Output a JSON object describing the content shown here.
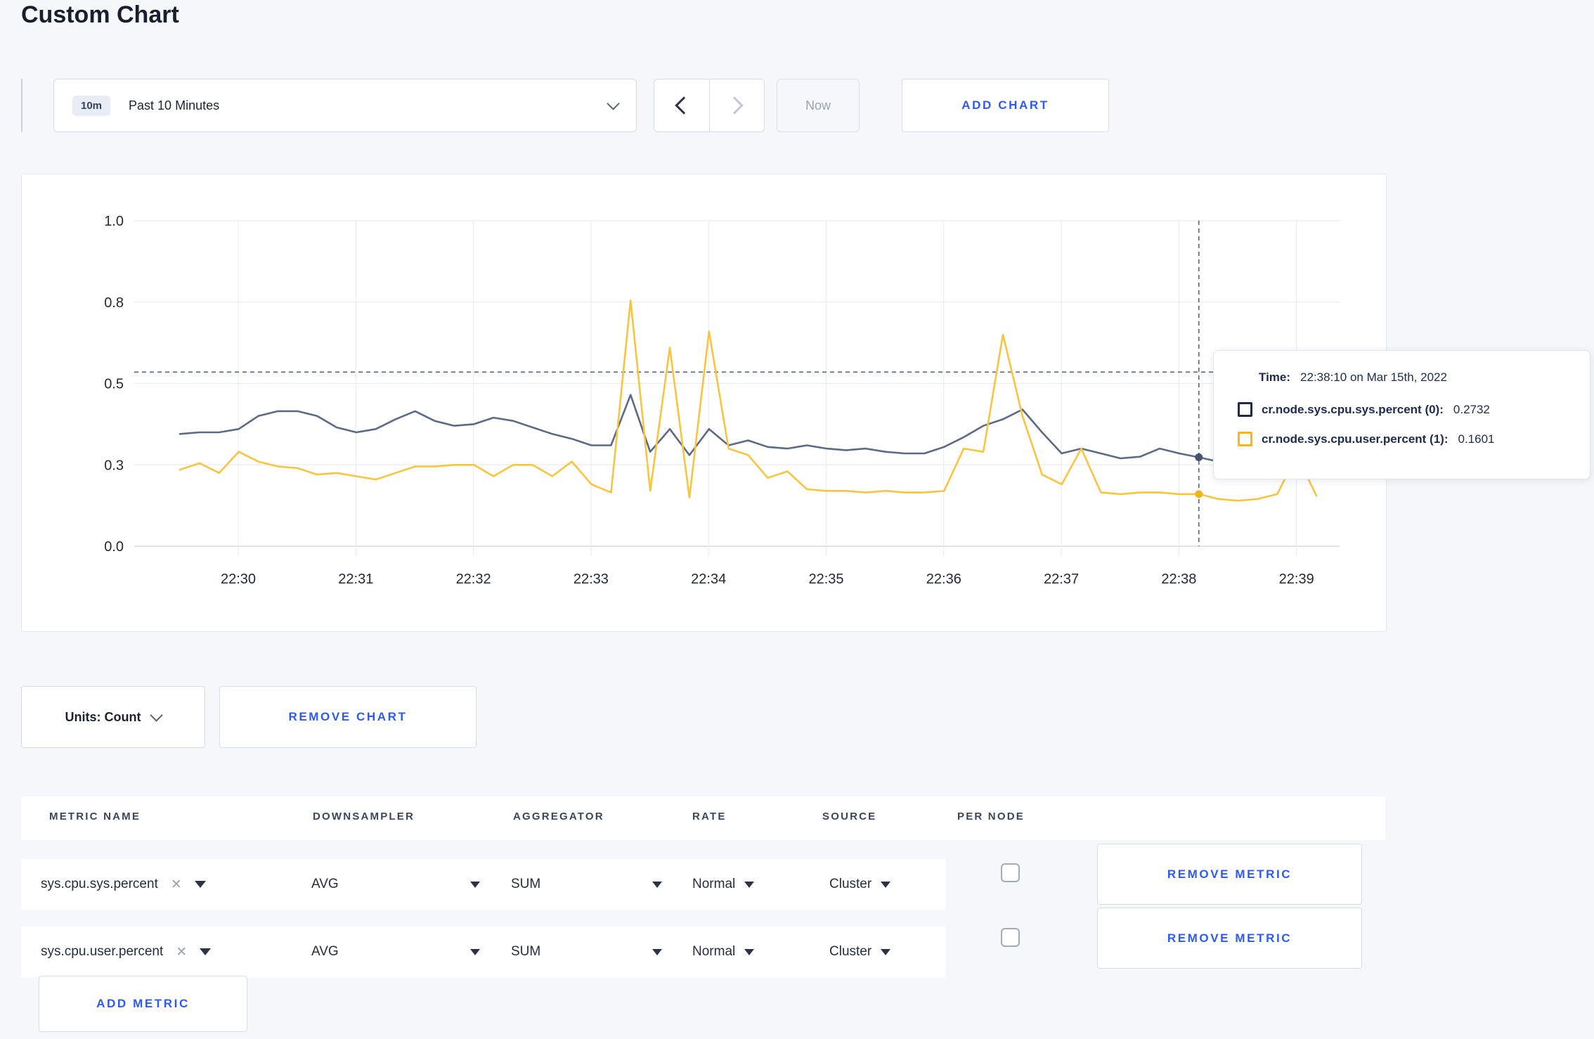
{
  "page": {
    "title": "Custom Chart",
    "background": "#f6f7fa",
    "accent_blue": "#2d5af0"
  },
  "toolbar": {
    "range_badge": "10m",
    "range_label": "Past 10 Minutes",
    "now_label": "Now",
    "add_chart_label": "ADD CHART"
  },
  "icons": {
    "close_x": "✕"
  },
  "chart_data": {
    "type": "line",
    "title": "",
    "xlabel": "",
    "ylabel": "",
    "ylim": [
      0,
      1
    ],
    "grid": true,
    "legend_position": "tooltip",
    "x_start_time": "22:29:30",
    "x_interval_seconds": 10,
    "x_tick_labels": [
      "22:30",
      "22:31",
      "22:32",
      "22:33",
      "22:34",
      "22:35",
      "22:36",
      "22:37",
      "22:38",
      "22:39"
    ],
    "y_ticks": [
      {
        "value": 0.0,
        "label": "0.0"
      },
      {
        "value": 0.25,
        "label": "0.3"
      },
      {
        "value": 0.5,
        "label": "0.5"
      },
      {
        "value": 0.75,
        "label": "0.8"
      },
      {
        "value": 1.0,
        "label": "1.0"
      }
    ],
    "series": [
      {
        "name": "cr.node.sys.cpu.sys.percent",
        "color": "#5d6a85",
        "dot_color": "#46536f",
        "values": [
          0.345,
          0.35,
          0.35,
          0.36,
          0.4,
          0.415,
          0.415,
          0.4,
          0.365,
          0.35,
          0.36,
          0.39,
          0.415,
          0.385,
          0.37,
          0.375,
          0.395,
          0.385,
          0.365,
          0.345,
          0.33,
          0.31,
          0.31,
          0.465,
          0.29,
          0.36,
          0.28,
          0.36,
          0.31,
          0.325,
          0.305,
          0.3,
          0.31,
          0.3,
          0.295,
          0.3,
          0.29,
          0.285,
          0.285,
          0.305,
          0.335,
          0.37,
          0.39,
          0.42,
          0.35,
          0.285,
          0.3,
          0.285,
          0.27,
          0.275,
          0.3,
          0.285,
          0.2732,
          0.26,
          0.27,
          0.275,
          0.27,
          0.275,
          0.27
        ]
      },
      {
        "name": "cr.node.sys.cpu.user.percent",
        "color": "#f8c540",
        "dot_color": "#f2b31c",
        "values": [
          0.235,
          0.255,
          0.225,
          0.29,
          0.26,
          0.245,
          0.24,
          0.22,
          0.225,
          0.215,
          0.205,
          0.225,
          0.245,
          0.245,
          0.25,
          0.25,
          0.215,
          0.25,
          0.25,
          0.215,
          0.26,
          0.19,
          0.165,
          0.755,
          0.17,
          0.61,
          0.15,
          0.66,
          0.3,
          0.28,
          0.21,
          0.23,
          0.175,
          0.17,
          0.17,
          0.165,
          0.17,
          0.165,
          0.165,
          0.17,
          0.3,
          0.29,
          0.65,
          0.4,
          0.22,
          0.19,
          0.3,
          0.165,
          0.16,
          0.165,
          0.165,
          0.16,
          0.1601,
          0.145,
          0.14,
          0.145,
          0.16,
          0.28,
          0.155
        ]
      }
    ],
    "crosshair": {
      "index": 52,
      "time": "22:38:10",
      "y_value": 0.535,
      "color": "#54667e"
    },
    "tooltip": {
      "time_label": "Time:",
      "time_value": "22:38:10 on Mar 15th, 2022",
      "entries": [
        {
          "name": "cr.node.sys.cpu.sys.percent (0):",
          "value": "0.2732",
          "color": "#1d2b4f"
        },
        {
          "name": "cr.node.sys.cpu.user.percent (1):",
          "value": "0.1601",
          "color": "#fdb515"
        }
      ]
    }
  },
  "units_row": {
    "units_label": "Units: Count",
    "remove_chart_label": "REMOVE CHART"
  },
  "metrics_table": {
    "headers": [
      "METRIC NAME",
      "DOWNSAMPLER",
      "AGGREGATOR",
      "RATE",
      "SOURCE",
      "PER NODE"
    ],
    "rows": [
      {
        "metric_name": "sys.cpu.sys.percent",
        "downsampler": "AVG",
        "aggregator": "SUM",
        "rate": "Normal",
        "source": "Cluster",
        "per_node_checked": false,
        "remove_label": "REMOVE METRIC"
      },
      {
        "metric_name": "sys.cpu.user.percent",
        "downsampler": "AVG",
        "aggregator": "SUM",
        "rate": "Normal",
        "source": "Cluster",
        "per_node_checked": false,
        "remove_label": "REMOVE METRIC"
      }
    ],
    "add_metric_label": "ADD METRIC"
  }
}
